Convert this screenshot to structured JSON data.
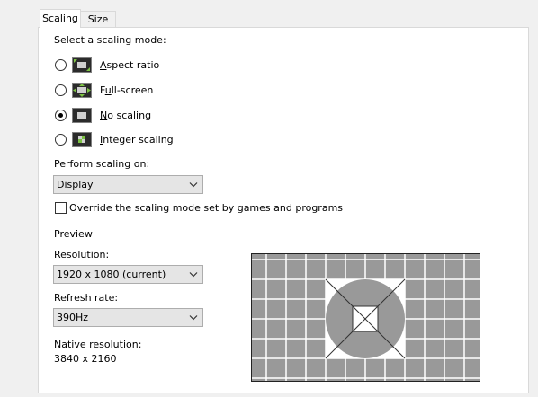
{
  "tabs": [
    {
      "label": "Scaling",
      "selected": true
    },
    {
      "label": "Size",
      "selected": false
    }
  ],
  "scaling_mode": {
    "heading": "Select a scaling mode:",
    "options": [
      {
        "mnemonic": "A",
        "rest": "spect ratio",
        "selected": false,
        "icon": "aspect-ratio-icon"
      },
      {
        "lead": "F",
        "mnemonic": "u",
        "rest": "ll-screen",
        "selected": false,
        "icon": "full-screen-icon"
      },
      {
        "mnemonic": "N",
        "rest": "o scaling",
        "selected": true,
        "icon": "no-scaling-icon"
      },
      {
        "mnemonic": "I",
        "rest": "nteger scaling",
        "selected": false,
        "icon": "integer-scaling-icon"
      }
    ]
  },
  "perform_scaling": {
    "label": "Perform scaling on:",
    "value": "Display"
  },
  "override": {
    "label": "Override the scaling mode set by games and programs",
    "checked": false
  },
  "preview": {
    "label": "Preview"
  },
  "resolution": {
    "label": "Resolution:",
    "value": "1920 x 1080 (current)"
  },
  "refresh_rate": {
    "label": "Refresh rate:",
    "value": "390Hz"
  },
  "native_resolution": {
    "label": "Native resolution:",
    "value": "3840 x 2160"
  },
  "colors": {
    "panel_bg": "#ffffff",
    "window_bg": "#f0f0f0",
    "combo_bg": "#e5e5e5",
    "icon_green": "#7cc243",
    "preview_grey": "#999999"
  }
}
